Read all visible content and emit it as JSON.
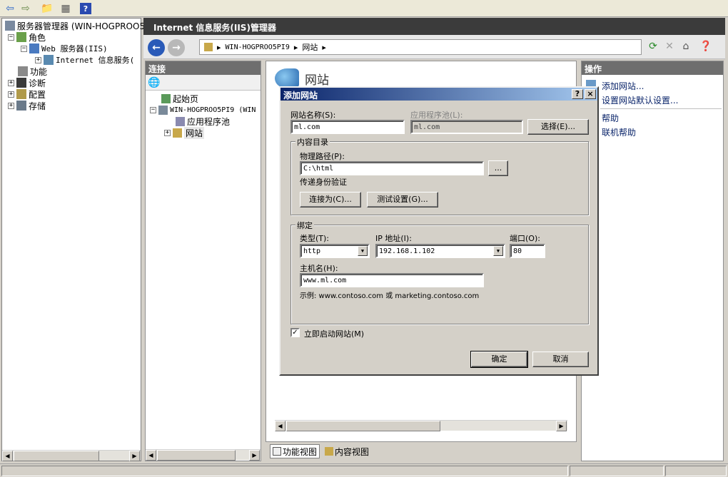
{
  "left_tree": {
    "root": "服务器管理器 (WIN-HOGPROO5PI",
    "roles": "角色",
    "web_server": "Web 服务器(IIS)",
    "iis_manager": "Internet 信息服务(",
    "features": "功能",
    "diagnostics": "诊断",
    "config": "配置",
    "storage": "存储"
  },
  "iis": {
    "header_title": "Internet 信息服务(IIS)管理器",
    "address_path": [
      "WIN-HOGPROO5PI9",
      "网站"
    ]
  },
  "connections": {
    "title": "连接",
    "start_page": "起始页",
    "server": "WIN-HOGPROO5PI9 (WIN",
    "app_pools": "应用程序池",
    "sites": "网站"
  },
  "center": {
    "title": "网站",
    "tab_features": "功能视图",
    "tab_content": "内容视图"
  },
  "actions": {
    "title": "操作",
    "add_site": "添加网站...",
    "set_defaults": "设置网站默认设置...",
    "help": "帮助",
    "online_help": "联机帮助"
  },
  "dialog": {
    "title": "添加网站",
    "help_btn": "?",
    "close_btn": "×",
    "site_name_label": "网站名称(S):",
    "site_name_value": "ml.com",
    "app_pool_label": "应用程序池(L):",
    "app_pool_value": "ml.com",
    "select_btn": "选择(E)...",
    "content_group": "内容目录",
    "physical_path_label": "物理路径(P):",
    "physical_path_value": "C:\\html",
    "browse_btn": "...",
    "pass_auth": "传递身份验证",
    "connect_as_btn": "连接为(C)...",
    "test_settings_btn": "测试设置(G)...",
    "binding_group": "绑定",
    "type_label": "类型(T):",
    "type_value": "http",
    "ip_label": "IP 地址(I):",
    "ip_value": "192.168.1.102",
    "port_label": "端口(O):",
    "port_value": "80",
    "host_label": "主机名(H):",
    "host_value": "www.ml.com",
    "example": "示例: www.contoso.com 或 marketing.contoso.com",
    "start_now_label": "立即启动网站(M)",
    "start_now_checked": true,
    "ok_btn": "确定",
    "cancel_btn": "取消"
  }
}
